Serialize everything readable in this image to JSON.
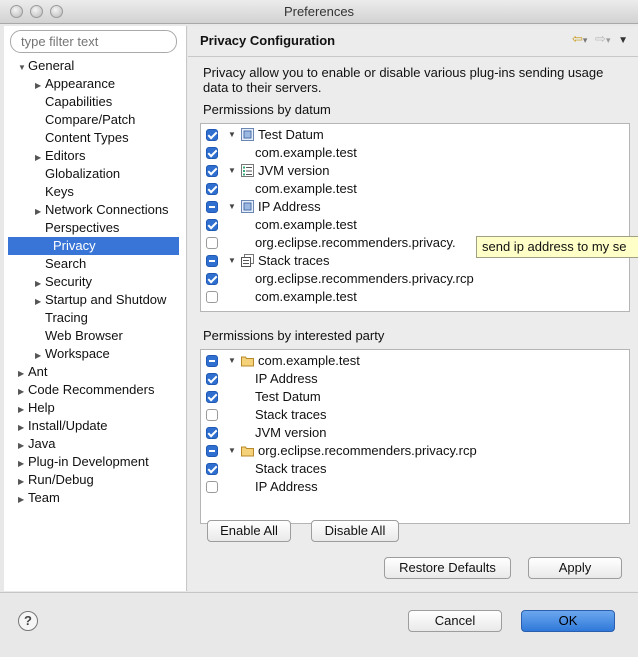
{
  "window": {
    "title": "Preferences"
  },
  "filter": {
    "placeholder": "type filter text"
  },
  "tree": [
    {
      "label": "General",
      "level": 0,
      "expanded": true,
      "has_children": true
    },
    {
      "label": "Appearance",
      "level": 1,
      "has_children": true
    },
    {
      "label": "Capabilities",
      "level": 1
    },
    {
      "label": "Compare/Patch",
      "level": 1
    },
    {
      "label": "Content Types",
      "level": 1
    },
    {
      "label": "Editors",
      "level": 1,
      "has_children": true
    },
    {
      "label": "Globalization",
      "level": 1
    },
    {
      "label": "Keys",
      "level": 1
    },
    {
      "label": "Network Connections",
      "level": 1,
      "has_children": true
    },
    {
      "label": "Perspectives",
      "level": 1
    },
    {
      "label": "Privacy",
      "level": 1,
      "selected": true
    },
    {
      "label": "Search",
      "level": 1
    },
    {
      "label": "Security",
      "level": 1,
      "has_children": true
    },
    {
      "label": "Startup and Shutdow",
      "level": 1,
      "has_children": true
    },
    {
      "label": "Tracing",
      "level": 1
    },
    {
      "label": "Web Browser",
      "level": 1
    },
    {
      "label": "Workspace",
      "level": 1,
      "has_children": true
    },
    {
      "label": "Ant",
      "level": 0,
      "has_children": true
    },
    {
      "label": "Code Recommenders",
      "level": 0,
      "has_children": true
    },
    {
      "label": "Help",
      "level": 0,
      "has_children": true
    },
    {
      "label": "Install/Update",
      "level": 0,
      "has_children": true
    },
    {
      "label": "Java",
      "level": 0,
      "has_children": true
    },
    {
      "label": "Plug-in Development",
      "level": 0,
      "has_children": true
    },
    {
      "label": "Run/Debug",
      "level": 0,
      "has_children": true
    },
    {
      "label": "Team",
      "level": 0,
      "has_children": true
    }
  ],
  "page": {
    "title": "Privacy Configuration",
    "description": "Privacy allow you to enable or disable various plug-ins sending usage data to their servers.",
    "datum_label": "Permissions by datum",
    "party_label": "Permissions by interested party"
  },
  "datum_rows": [
    {
      "label": "Test Datum",
      "level": 0,
      "state": "checked",
      "icon": "datum-icon"
    },
    {
      "label": "com.example.test",
      "level": 1,
      "state": "checked"
    },
    {
      "label": "JVM version",
      "level": 0,
      "state": "checked",
      "icon": "list-icon"
    },
    {
      "label": "com.example.test",
      "level": 1,
      "state": "checked"
    },
    {
      "label": "IP Address",
      "level": 0,
      "state": "mixed",
      "icon": "datum-icon"
    },
    {
      "label": "com.example.test",
      "level": 1,
      "state": "checked"
    },
    {
      "label": "org.eclipse.recommenders.privacy.",
      "level": 1,
      "state": "unchecked"
    },
    {
      "label": "Stack traces",
      "level": 0,
      "state": "mixed",
      "icon": "stack-icon"
    },
    {
      "label": "org.eclipse.recommenders.privacy.rcp",
      "level": 1,
      "state": "checked"
    },
    {
      "label": "com.example.test",
      "level": 1,
      "state": "unchecked"
    }
  ],
  "party_rows": [
    {
      "label": "com.example.test",
      "level": 0,
      "state": "mixed",
      "icon": "folder-icon"
    },
    {
      "label": "IP Address",
      "level": 1,
      "state": "checked"
    },
    {
      "label": "Test Datum",
      "level": 1,
      "state": "checked"
    },
    {
      "label": "Stack traces",
      "level": 1,
      "state": "unchecked"
    },
    {
      "label": "JVM version",
      "level": 1,
      "state": "checked"
    },
    {
      "label": "org.eclipse.recommenders.privacy.rcp",
      "level": 0,
      "state": "mixed",
      "icon": "folder-icon"
    },
    {
      "label": "Stack traces",
      "level": 1,
      "state": "checked"
    },
    {
      "label": "IP Address",
      "level": 1,
      "state": "unchecked"
    }
  ],
  "tooltip": "send ip address to my se",
  "buttons": {
    "enable_all": "Enable All",
    "disable_all": "Disable All",
    "restore_defaults": "Restore Defaults",
    "apply": "Apply",
    "cancel": "Cancel",
    "ok": "OK",
    "help": "?"
  },
  "nav": {
    "back": "⇦",
    "forward": "⇨",
    "menu": "▼",
    "dropdown": "▾"
  },
  "colors": {
    "selection": "#3875d7",
    "checkbox": "#2f6fcf",
    "tooltip_bg": "#ffffc8"
  }
}
